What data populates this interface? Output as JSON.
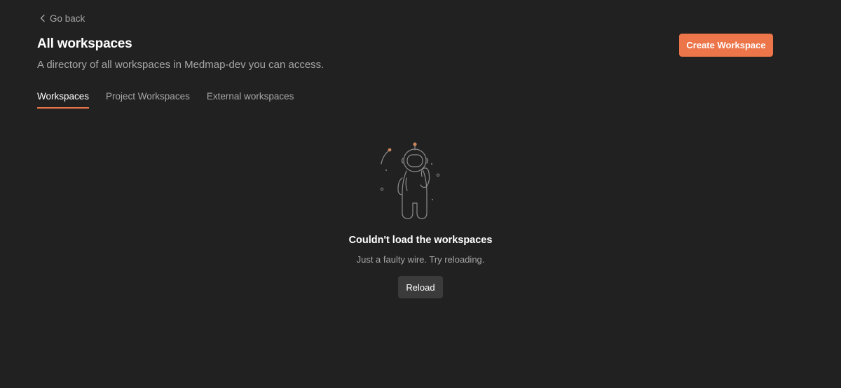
{
  "header": {
    "back_label": "Go back",
    "title": "All workspaces",
    "subtitle": "A directory of all workspaces in Medmap-dev you can access.",
    "create_button_label": "Create Workspace"
  },
  "tabs": [
    {
      "label": "Workspaces",
      "active": true
    },
    {
      "label": "Project Workspaces",
      "active": false
    },
    {
      "label": "External workspaces",
      "active": false
    }
  ],
  "empty_state": {
    "title": "Couldn't load the workspaces",
    "description": "Just a faulty wire. Try reloading.",
    "reload_label": "Reload"
  },
  "colors": {
    "background": "#212121",
    "accent": "#ec7549",
    "muted_text": "#a6a6a6",
    "secondary_button": "#3b3b3b"
  },
  "icons": {
    "back": "chevron-left-icon",
    "illustration": "astronaut-illustration"
  }
}
